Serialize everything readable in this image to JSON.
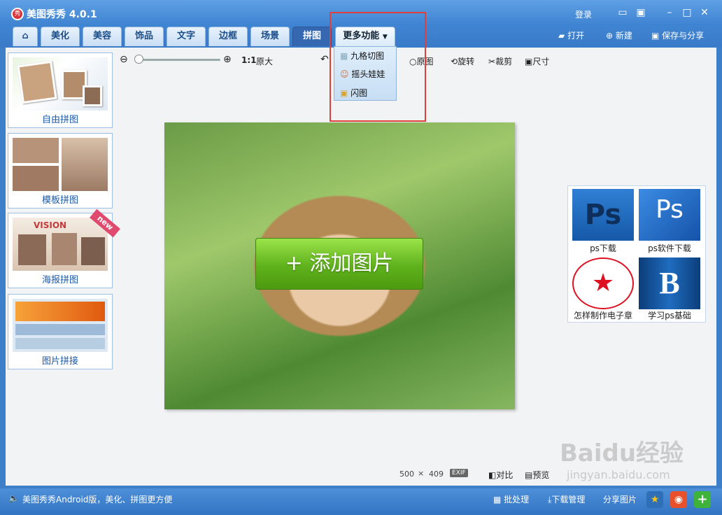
{
  "window": {
    "title": "美图秀秀 4.0.1",
    "login": "登录"
  },
  "tabs": [
    {
      "label": "美化"
    },
    {
      "label": "美容"
    },
    {
      "label": "饰品"
    },
    {
      "label": "文字"
    },
    {
      "label": "边框"
    },
    {
      "label": "场景"
    },
    {
      "label": "拼图"
    },
    {
      "label": "更多功能"
    }
  ],
  "actions": {
    "open": "打开",
    "new": "新建",
    "save_share": "保存与分享"
  },
  "dropdown": {
    "items": [
      {
        "label": "九格切图"
      },
      {
        "label": "摇头娃娃"
      },
      {
        "label": "闪图"
      }
    ]
  },
  "toolbar": {
    "ratio": "1:1",
    "original_size": "原大",
    "original": "原图",
    "rotate": "旋转",
    "crop": "裁剪",
    "size": "尺寸"
  },
  "sidebar": {
    "items": [
      {
        "label": "自由拼图"
      },
      {
        "label": "模板拼图"
      },
      {
        "label": "海报拼图",
        "badge": "new"
      },
      {
        "label": "图片拼接"
      }
    ]
  },
  "canvas": {
    "add_button": "+ 添加图片",
    "width": "500",
    "times": "×",
    "height": "409",
    "exif": "EXIF",
    "compare": "对比",
    "preview": "预览"
  },
  "ads": [
    {
      "label": "ps下载",
      "thumb": "Ps"
    },
    {
      "label": "ps软件下载",
      "thumb": "Ps"
    },
    {
      "label": "怎样制作电子章",
      "thumb": "★"
    },
    {
      "label": "学习ps基础",
      "thumb": "B"
    }
  ],
  "statusbar": {
    "message": "美图秀秀Android版，美化、拼图更方便",
    "batch": "批处理",
    "download": "下载管理",
    "share": "分享图片"
  },
  "watermark": {
    "text": "Baidu经验",
    "url": "jingyan.baidu.com"
  },
  "colors": {
    "accent": "#3f84d2",
    "highlight": "#e0403c",
    "add_green": "#5fb21c"
  }
}
